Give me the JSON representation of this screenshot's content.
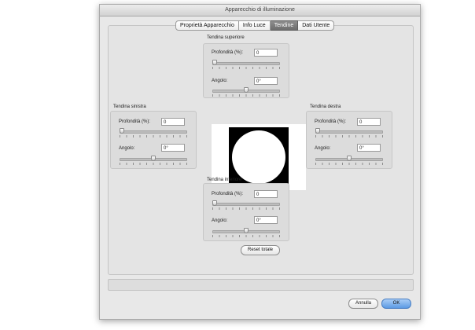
{
  "window": {
    "title": "Apparecchio di illuminazione"
  },
  "tabs": [
    {
      "label": "Proprietà Apparecchio",
      "active": false
    },
    {
      "label": "Info Luce",
      "active": false
    },
    {
      "label": "Tendine",
      "active": true
    },
    {
      "label": "Dati Utente",
      "active": false
    }
  ],
  "shutters": {
    "top": {
      "title": "Tendina superiore",
      "depth_label": "Profondità (%):",
      "depth_value": "0",
      "angle_label": "Angolo:",
      "angle_value": "0°",
      "depth_slider_fraction": 0.0,
      "angle_slider_fraction": 0.5
    },
    "left": {
      "title": "Tendina sinistra",
      "depth_label": "Profondità (%):",
      "depth_value": "0",
      "angle_label": "Angolo:",
      "angle_value": "0°",
      "depth_slider_fraction": 0.0,
      "angle_slider_fraction": 0.5
    },
    "right": {
      "title": "Tendina destra",
      "depth_label": "Profondità (%):",
      "depth_value": "0",
      "angle_label": "Angolo:",
      "angle_value": "0°",
      "depth_slider_fraction": 0.0,
      "angle_slider_fraction": 0.5
    },
    "bottom": {
      "title": "Tendina inferiore",
      "depth_label": "Profondità (%):",
      "depth_value": "0",
      "angle_label": "Angolo:",
      "angle_value": "0°",
      "depth_slider_fraction": 0.0,
      "angle_slider_fraction": 0.5
    }
  },
  "buttons": {
    "reset": "Reset totale",
    "cancel": "Annulla",
    "ok": "OK"
  },
  "colors": {
    "primary_button": "#5b9ae4",
    "active_tab": "#7a7a7a"
  }
}
